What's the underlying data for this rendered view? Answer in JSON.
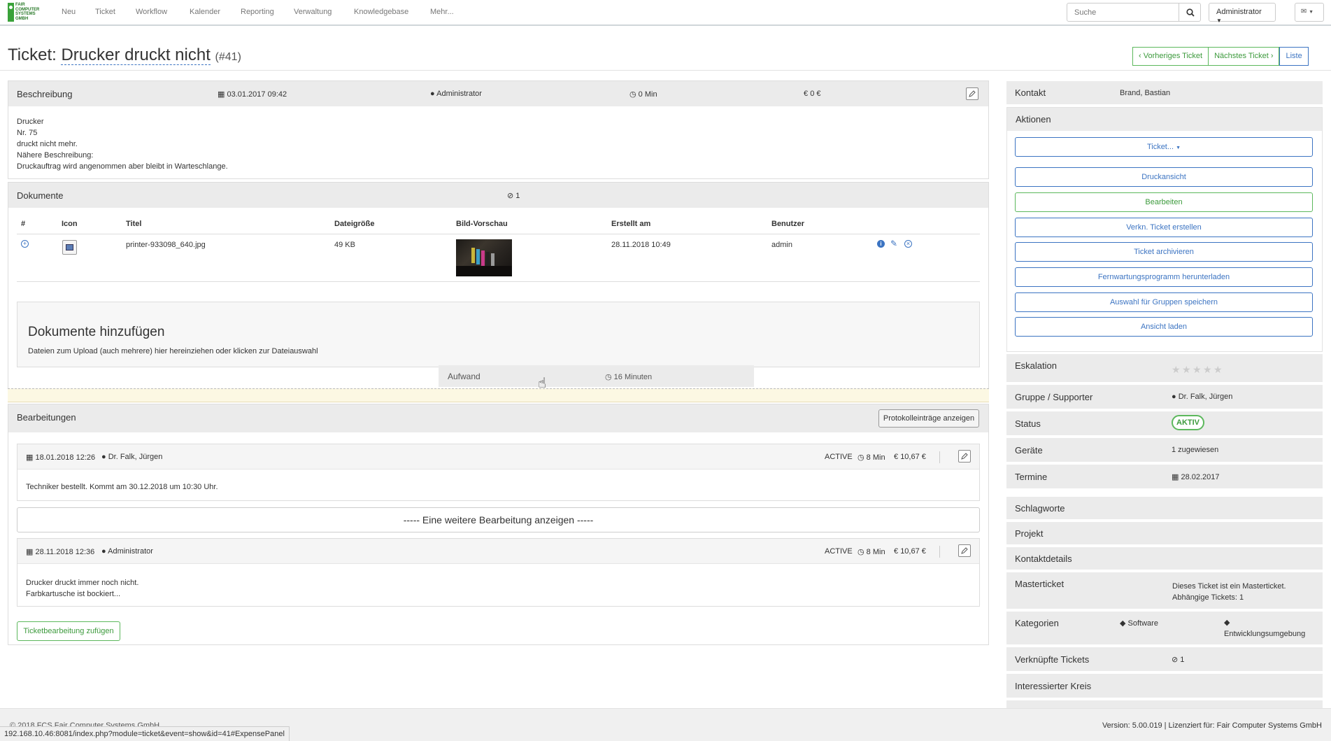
{
  "brand": {
    "logo_text": "FAIR COMPUTER SYSTEMS GMBH",
    "accent": "#5cb85c",
    "link": "#3c74c2"
  },
  "nav": {
    "items": [
      "Neu",
      "Ticket",
      "Workflow",
      "Kalender",
      "Reporting",
      "Verwaltung",
      "Knowledgebase",
      "Mehr..."
    ],
    "search_placeholder": "Suche",
    "user_menu": "Administrator",
    "mail_icon": "envelope-icon"
  },
  "ticket": {
    "prefix": "Ticket:",
    "name": "Drucker druckt nicht",
    "id": "(#41)",
    "prev": "Vorheriges Ticket",
    "next": "Nächstes Ticket",
    "list": "Liste"
  },
  "beschreibung": {
    "title": "Beschreibung",
    "date": "03.01.2017 09:42",
    "user": "Administrator",
    "time": "0 Min",
    "cost": "0 €",
    "lines": [
      "Drucker",
      "Nr. 75",
      "druckt nicht mehr.",
      "Nähere Beschreibung:",
      "Druckauftrag wird angenommen aber bleibt in Warteschlange."
    ]
  },
  "dokumente": {
    "title": "Dokumente",
    "count": "1",
    "headers": [
      "#",
      "Icon",
      "Titel",
      "Dateigröße",
      "Bild-Vorschau",
      "Erstellt am",
      "Benutzer"
    ],
    "rows": [
      {
        "title": "printer-933098_640.jpg",
        "size": "49 KB",
        "created": "28.11.2018 10:49",
        "user": "admin"
      }
    ],
    "add_title": "Dokumente hinzufügen",
    "add_hint": "Dateien zum Upload (auch mehrere) hier hereinziehen oder klicken zur Dateiauswahl"
  },
  "aufwand": {
    "label": "Aufwand",
    "value": "16 Minuten"
  },
  "bearbeitungen": {
    "title": "Bearbeitungen",
    "log_button": "Protokolleinträge anzeigen",
    "entries": [
      {
        "date": "18.01.2018 12:26",
        "user": "Dr. Falk, Jürgen",
        "status": "ACTIVE",
        "time": "8 Min",
        "cost": "10,67 €",
        "lines": [
          "Techniker bestellt. Kommt am 30.12.2018 um 10:30 Uhr."
        ]
      },
      {
        "date": "28.11.2018 12:36",
        "user": "Administrator",
        "status": "ACTIVE",
        "time": "8 Min",
        "cost": "10,67 €",
        "lines": [
          "Drucker druckt immer noch nicht.",
          "Farbkartusche ist bockiert..."
        ]
      }
    ],
    "show_more": "----- Eine weitere Bearbeitung anzeigen -----",
    "add_button": "Ticketbearbeitung zufügen"
  },
  "sidebar": {
    "kontakt_label": "Kontakt",
    "kontakt_value": "Brand, Bastian",
    "aktionen_label": "Aktionen",
    "actions": [
      "Ticket...",
      "Druckansicht",
      "Bearbeiten",
      "Verkn. Ticket erstellen",
      "Ticket archivieren",
      "Fernwartungsprogramm herunterladen",
      "Auswahl für Gruppen speichern",
      "Ansicht laden"
    ],
    "eskalation_label": "Eskalation",
    "eskalation_stars": 0,
    "gruppe_label": "Gruppe / Supporter",
    "gruppe_value": "Dr. Falk, Jürgen",
    "status_label": "Status",
    "status_value": "AKTIV",
    "geraete_label": "Geräte",
    "geraete_value": "1 zugewiesen",
    "termine_label": "Termine",
    "termine_value": "28.02.2017",
    "schlagworte_label": "Schlagworte",
    "projekt_label": "Projekt",
    "kontaktdetails_label": "Kontaktdetails",
    "masterticket_label": "Masterticket",
    "masterticket_line1": "Dieses Ticket ist ein Masterticket.",
    "masterticket_line2": "Abhängige Tickets: 1",
    "kategorien_label": "Kategorien",
    "kategorie1": "Software",
    "kategorie2": "Entwicklungsumgebung",
    "verknuepft_label": "Verknüpfte Tickets",
    "verknuepft_value": "1",
    "kreis_label": "Interessierter Kreis"
  },
  "footer": {
    "copyright": "© 2018 FCS Fair Computer Systems GmbH",
    "version": "Version: 5.00.019 | Lizenziert für: Fair Computer Systems GmbH",
    "status_url": "192.168.10.46:8081/index.php?module=ticket&event=show&id=41#ExpensePanel"
  }
}
